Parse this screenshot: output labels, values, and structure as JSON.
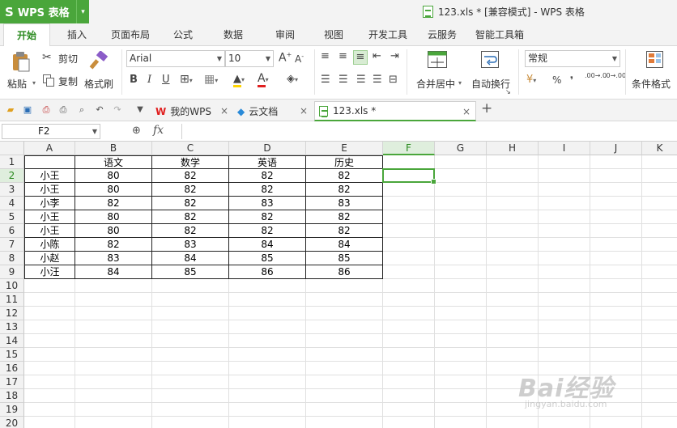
{
  "app": {
    "name": "WPS 表格",
    "logo": "S",
    "brand_color": "#4aa63b"
  },
  "window": {
    "title": "123.xls * [兼容模式] - WPS 表格"
  },
  "menu_tabs": [
    "开始",
    "插入",
    "页面布局",
    "公式",
    "数据",
    "审阅",
    "视图",
    "开发工具",
    "云服务",
    "智能工具箱"
  ],
  "ribbon": {
    "paste": "粘贴",
    "cut": "剪切",
    "copy": "复制",
    "format_painter": "格式刷",
    "font_name": "Arial",
    "font_size": "10",
    "merge_center": "合并居中",
    "wrap_text": "自动换行",
    "number_format": "常规",
    "percent": "%",
    "comma": "❜",
    "decimal_inc": ".00→.0",
    "decimal_dec": ".0→.00",
    "cond_format": "条件格式"
  },
  "doc_tabs": [
    {
      "label": "我的WPS",
      "icon": "wps-logo-icon"
    },
    {
      "label": "云文档",
      "icon": "cloud-cube-icon"
    },
    {
      "label": "123.xls *",
      "icon": "spreadsheet-file-icon",
      "active": true
    }
  ],
  "formula_bar": {
    "name_box": "F2",
    "fx": "fx",
    "value": ""
  },
  "sheet": {
    "columns": [
      "A",
      "B",
      "C",
      "D",
      "E",
      "F",
      "G",
      "H",
      "I",
      "J",
      "K"
    ],
    "rows": [
      "1",
      "2",
      "3",
      "4",
      "5",
      "6",
      "7",
      "8",
      "9",
      "10",
      "11",
      "12",
      "13",
      "14",
      "15",
      "16",
      "17",
      "18",
      "19",
      "20"
    ],
    "selected_cell": "F2",
    "data": [
      [
        "",
        "语文",
        "数学",
        "英语",
        "历史"
      ],
      [
        "小王",
        "80",
        "82",
        "82",
        "82"
      ],
      [
        "小王",
        "80",
        "82",
        "82",
        "82"
      ],
      [
        "小李",
        "82",
        "82",
        "83",
        "83"
      ],
      [
        "小王",
        "80",
        "82",
        "82",
        "82"
      ],
      [
        "小王",
        "80",
        "82",
        "82",
        "82"
      ],
      [
        "小陈",
        "82",
        "83",
        "84",
        "84"
      ],
      [
        "小赵",
        "83",
        "84",
        "85",
        "85"
      ],
      [
        "小汪",
        "84",
        "85",
        "86",
        "86"
      ]
    ]
  },
  "watermark": {
    "brand": "Bai经验",
    "url": "jingyan.baidu.com"
  }
}
